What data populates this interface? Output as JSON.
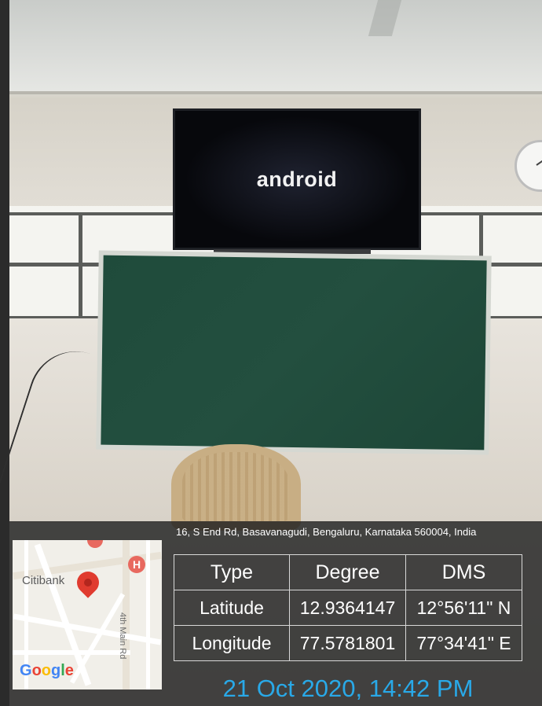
{
  "tv": {
    "screen_text": "android"
  },
  "stamp": {
    "address": "16, S End Rd, Basavanagudi, Bengaluru, Karnataka 560004, India",
    "map": {
      "poi_label": "Citibank",
      "road_label": "4th Main Rd",
      "provider": "Google",
      "hospital_marker": "H"
    },
    "table": {
      "headers": [
        "Type",
        "Degree",
        "DMS"
      ],
      "rows": [
        [
          "Latitude",
          "12.9364147",
          "12°56'11\" N"
        ],
        [
          "Longitude",
          "77.5781801",
          "77°34'41\" E"
        ]
      ]
    },
    "datetime": "21 Oct 2020, 14:42 PM"
  },
  "colors": {
    "datetime": "#29a9e8",
    "pin": "#e03b2f",
    "board": "#1f4b3b"
  }
}
